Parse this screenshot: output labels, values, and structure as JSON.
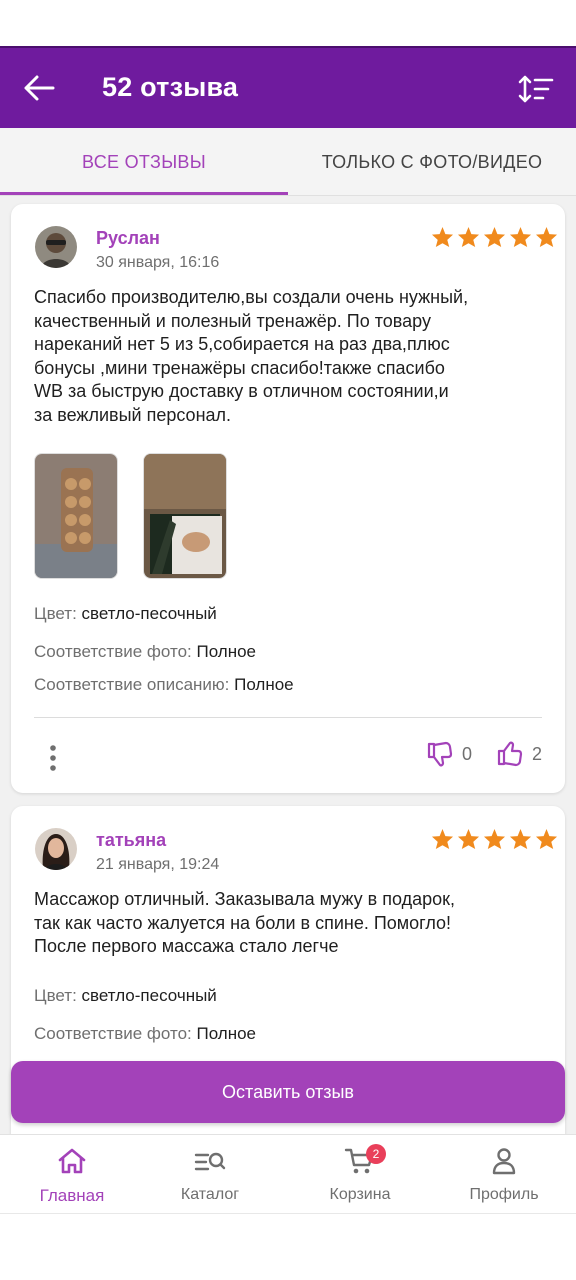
{
  "header": {
    "title": "52 отзыва",
    "bar_color": "#6f1b9e"
  },
  "tabs": [
    {
      "label": "ВСЕ ОТЗЫВЫ",
      "active": true
    },
    {
      "label": "ТОЛЬКО С ФОТО/ВИДЕО",
      "active": false
    }
  ],
  "reviews": [
    {
      "author": "Руслан",
      "date": "30 января, 16:16",
      "rating": 5,
      "text_lines": [
        "Спасибо производителю,вы создали очень нужный,",
        "качественный и полезный тренажёр. По товару",
        "нареканий нет 5 из 5,собирается на раз два,плюс",
        "бонусы ,мини тренажёры спасибо!также спасибо",
        "WB за быструю доставку в отличном состоянии,и",
        "за вежливый персонал."
      ],
      "photos": [
        "massager-photo",
        "box-photo"
      ],
      "attributes": [
        {
          "label": "Цвет: ",
          "value": "светло-песочный"
        },
        {
          "label": "Соответствие фото: ",
          "value": "Полное"
        },
        {
          "label": "Соответствие описанию: ",
          "value": "Полное"
        }
      ],
      "dislikes": "0",
      "likes": "2"
    },
    {
      "author": "татьяна",
      "date": "21 января, 19:24",
      "rating": 5,
      "text_lines": [
        "Массажор отличный. Заказывала мужу в подарок,",
        "так как часто жалуется на боли в спине. Помогло!",
        "После первого массажа стало легче"
      ],
      "attributes": [
        {
          "label": "Цвет: ",
          "value": "светло-песочный"
        },
        {
          "label": "Соответствие фото: ",
          "value": "Полное"
        }
      ]
    }
  ],
  "leave_review_button": "Оставить отзыв",
  "bottom_nav": [
    {
      "label": "Главная",
      "icon": "home-icon",
      "active": true
    },
    {
      "label": "Каталог",
      "icon": "catalog-search-icon",
      "active": false
    },
    {
      "label": "Корзина",
      "icon": "cart-icon",
      "active": false,
      "badge": "2"
    },
    {
      "label": "Профиль",
      "icon": "profile-icon",
      "active": false
    }
  ],
  "colors": {
    "accent": "#a342b9",
    "star": "#f08a1d",
    "badge": "#e93f5a"
  }
}
